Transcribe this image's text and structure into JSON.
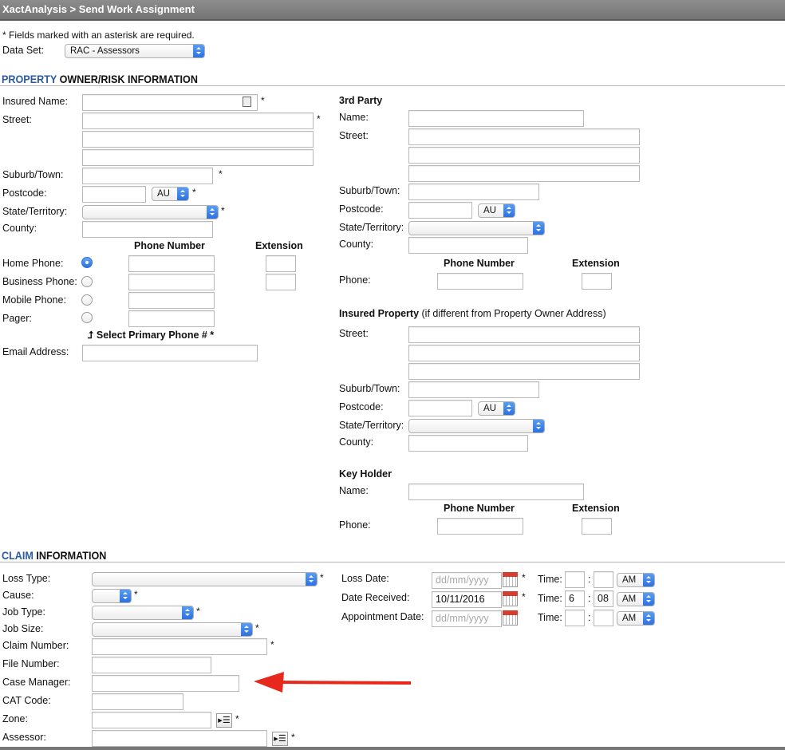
{
  "header": {
    "title": "XactAnalysis > Send Work Assignment"
  },
  "required_note": "* Fields marked with an asterisk are required.",
  "data_set": {
    "label": "Data Set:",
    "value": "RAC - Assessors"
  },
  "property_section": {
    "title_accent": "PROPERTY",
    "title_rest": " OWNER/RISK INFORMATION"
  },
  "owner": {
    "insured_name": "Insured Name:",
    "street": "Street:",
    "suburb": "Suburb/Town:",
    "postcode": "Postcode:",
    "country": "AU",
    "state": "State/Territory:",
    "county": "County:",
    "phone_number_hdr": "Phone Number",
    "extension_hdr": "Extension",
    "home_phone": "Home Phone:",
    "business_phone": "Business Phone:",
    "mobile_phone": "Mobile Phone:",
    "pager": "Pager:",
    "select_primary": "Select Primary Phone # *",
    "email": "Email Address:"
  },
  "third_party": {
    "title": "3rd Party",
    "name": "Name:",
    "street": "Street:",
    "suburb": "Suburb/Town:",
    "postcode": "Postcode:",
    "country": "AU",
    "state": "State/Territory:",
    "county": "County:",
    "phone_number_hdr": "Phone Number",
    "extension_hdr": "Extension",
    "phone": "Phone:"
  },
  "insured_property": {
    "title": "Insured Property",
    "title_note": " (if different from Property Owner Address)",
    "street": "Street:",
    "suburb": "Suburb/Town:",
    "postcode": "Postcode:",
    "country": "AU",
    "state": "State/Territory:",
    "county": "County:"
  },
  "key_holder": {
    "title": "Key Holder",
    "name": "Name:",
    "phone_number_hdr": "Phone Number",
    "extension_hdr": "Extension",
    "phone": "Phone:"
  },
  "claim_section": {
    "title_accent": "CLAIM",
    "title_rest": " INFORMATION"
  },
  "claim": {
    "loss_type": "Loss Type:",
    "cause": "Cause:",
    "job_type": "Job Type:",
    "job_size": "Job Size:",
    "claim_number": "Claim Number:",
    "file_number": "File Number:",
    "case_manager": "Case Manager:",
    "cat_code": "CAT Code:",
    "zone": "Zone:",
    "assessor": "Assessor:"
  },
  "dates": {
    "loss_date": "Loss Date:",
    "loss_date_placeholder": "dd/mm/yyyy",
    "date_received": "Date Received:",
    "date_received_value": "10/11/2016",
    "appointment_date": "Appointment Date:",
    "appointment_placeholder": "dd/mm/yyyy",
    "time_label": "Time:",
    "loss_hour": "",
    "loss_min": "",
    "loss_ampm": "AM",
    "received_hour": "6",
    "received_min": "08",
    "received_ampm": "AM",
    "appt_hour": "",
    "appt_min": "",
    "appt_ampm": "AM"
  },
  "asterisk": "*",
  "colon": ":",
  "annotation": {
    "arrow_color": "#e8281c"
  }
}
